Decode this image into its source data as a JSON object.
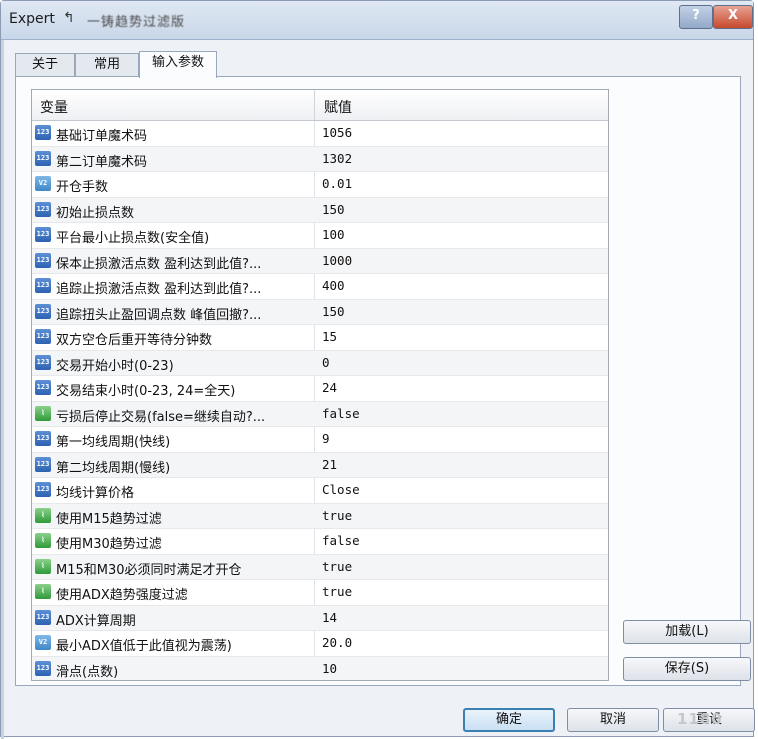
{
  "window": {
    "title": "Expert",
    "subtitle": "一铸趋势过滤版",
    "help_label": "?",
    "close_label": "X"
  },
  "tabs": [
    {
      "label": "关于"
    },
    {
      "label": "常用"
    },
    {
      "label": "输入参数"
    }
  ],
  "table": {
    "headers": {
      "name": "变量",
      "value": "赋值"
    },
    "rows": [
      {
        "icon": "int",
        "name": "基础订单魔术码",
        "value": "1056"
      },
      {
        "icon": "int",
        "name": "第二订单魔术码",
        "value": "1302"
      },
      {
        "icon": "dbl",
        "name": "开仓手数",
        "value": "0.01"
      },
      {
        "icon": "int",
        "name": "初始止损点数",
        "value": "150"
      },
      {
        "icon": "int",
        "name": "平台最小止损点数(安全值)",
        "value": "100"
      },
      {
        "icon": "int",
        "name": "保本止损激活点数 盈利达到此值?...",
        "value": "1000"
      },
      {
        "icon": "int",
        "name": "追踪止损激活点数 盈利达到此值?...",
        "value": "400"
      },
      {
        "icon": "int",
        "name": "追踪扭头止盈回调点数 峰值回撤?...",
        "value": "150"
      },
      {
        "icon": "int",
        "name": "双方空仓后重开等待分钟数",
        "value": "15"
      },
      {
        "icon": "int",
        "name": "交易开始小时(0-23)",
        "value": "0"
      },
      {
        "icon": "int",
        "name": "交易结束小时(0-23, 24=全天)",
        "value": "24"
      },
      {
        "icon": "bool",
        "name": "亏损后停止交易(false=继续自动?...",
        "value": "false"
      },
      {
        "icon": "int",
        "name": "第一均线周期(快线)",
        "value": "9"
      },
      {
        "icon": "int",
        "name": "第二均线周期(慢线)",
        "value": "21"
      },
      {
        "icon": "int",
        "name": "均线计算价格",
        "value": "Close"
      },
      {
        "icon": "bool",
        "name": "使用M15趋势过滤",
        "value": "true"
      },
      {
        "icon": "bool",
        "name": "使用M30趋势过滤",
        "value": "false"
      },
      {
        "icon": "bool",
        "name": "M15和M30必须同时满足才开仓",
        "value": "true"
      },
      {
        "icon": "bool",
        "name": "使用ADX趋势强度过滤",
        "value": "true"
      },
      {
        "icon": "int",
        "name": "ADX计算周期",
        "value": "14"
      },
      {
        "icon": "dbl",
        "name": "最小ADX值低于此值视为震荡)",
        "value": "20.0"
      },
      {
        "icon": "int",
        "name": "滑点(点数)",
        "value": "10"
      }
    ]
  },
  "icon_labels": {
    "int": "123",
    "dbl": "V2",
    "bool": "⌇"
  },
  "side_buttons": {
    "load": "加载(L)",
    "save": "保存(S)"
  },
  "bottom_buttons": {
    "ok": "确定",
    "cancel": "取消",
    "reset": "重设"
  },
  "watermark": "1180"
}
